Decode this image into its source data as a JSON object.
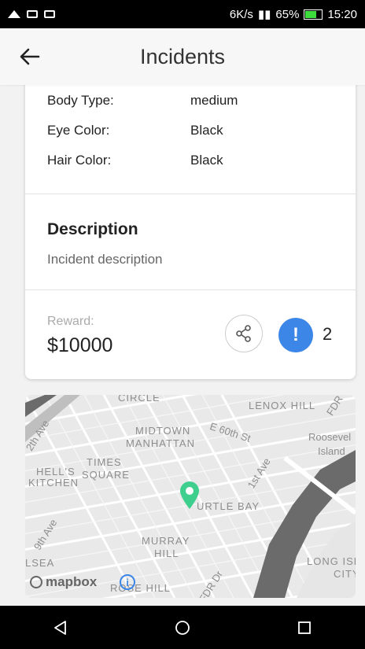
{
  "status_bar": {
    "speed": "6K/s",
    "battery": "65%",
    "time": "15:20"
  },
  "app_bar": {
    "title": "Incidents",
    "back_icon": "arrow-left-icon"
  },
  "details": {
    "rows": [
      {
        "label": "Body Type:",
        "value": "medium"
      },
      {
        "label": "Eye Color:",
        "value": "Black"
      },
      {
        "label": "Hair Color:",
        "value": "Black"
      }
    ]
  },
  "description": {
    "title": "Description",
    "text": "Incident description"
  },
  "reward": {
    "label": "Reward:",
    "value": "$10000",
    "alert_count": "2",
    "share_icon": "share-icon",
    "alert_icon": "exclamation-icon",
    "alert_color": "#3b86e6"
  },
  "map": {
    "labels": {
      "circle": "CIRCLE",
      "lenox_hill": "LENOX HILL",
      "midtown": "MIDTOWN",
      "manhattan": "MANHATTAN",
      "roosevelt": "Roosevel",
      "island": "Island",
      "times": "TIMES",
      "square": "SQUARE",
      "hells": "HELL'S",
      "kitchen": "KITCHEN",
      "turtle_bay": "URTLE BAY",
      "murray": "MURRAY",
      "hill": "HILL",
      "rose_hill": "ROSE HILL",
      "chelsea": "LSEA",
      "long_isl": "LONG ISL",
      "city": "CITY"
    },
    "streets": {
      "e60": "E 60th St",
      "first_ave": "1st Ave",
      "twelfth": "2th Ave",
      "ninth": "9th Ave",
      "fdr1": "FDR",
      "fdr2": "FDR Dr"
    },
    "attribution": "mapbox",
    "pin_color": "#3ecf8e"
  },
  "nav_bar": {
    "back": "triangle-back-icon",
    "home": "circle-home-icon",
    "recents": "square-recents-icon"
  }
}
